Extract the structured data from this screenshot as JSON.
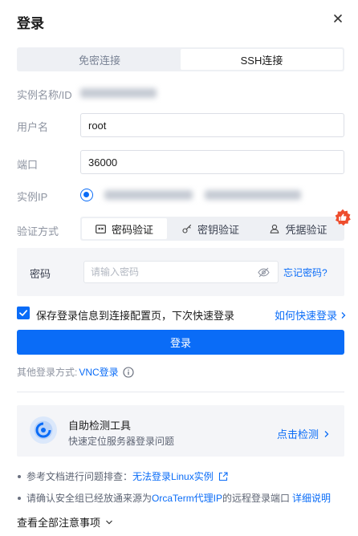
{
  "dialog": {
    "title": "登录",
    "close_icon": "close-icon"
  },
  "tabs": [
    {
      "label": "免密连接",
      "active": false
    },
    {
      "label": "SSH连接",
      "active": true
    }
  ],
  "form": {
    "instance_name_label": "实例名称/ID",
    "username_label": "用户名",
    "username_value": "root",
    "port_label": "端口",
    "port_value": "36000",
    "instance_ip_label": "实例IP",
    "auth_label": "验证方式",
    "auth_methods": [
      {
        "label": "密码验证",
        "icon": "password-icon",
        "active": true
      },
      {
        "label": "密钥验证",
        "icon": "key-icon",
        "active": false
      },
      {
        "label": "凭据验证",
        "icon": "credential-icon",
        "active": false
      }
    ],
    "password_label": "密码",
    "password_placeholder": "请输入密码",
    "forgot_password": "忘记密码?"
  },
  "save_option": {
    "checked": true,
    "label": "保存登录信息到连接配置页，下次快速登录",
    "quick_login_link": "如何快速登录"
  },
  "login_button": "登录",
  "other_login": {
    "label": "其他登录方式:",
    "vnc_link": "VNC登录"
  },
  "self_check": {
    "title": "自助检测工具",
    "subtitle": "快速定位服务器登录问题",
    "action": "点击检测"
  },
  "references": {
    "ref1_prefix": "参考文档进行问题排查：",
    "ref1_link": "无法登录Linux实例",
    "ref2_prefix": "请确认安全组已经放通来源为",
    "ref2_link": "OrcaTerm代理IP",
    "ref2_suffix": "的远程登录端口",
    "ref2_detail": "详细说明"
  },
  "view_all": "查看全部注意事项",
  "colors": {
    "primary": "#0a6cf7",
    "label_gray": "#8d93a0",
    "panel_bg": "#f4f5f8",
    "badge_red": "#ee4d2d"
  }
}
